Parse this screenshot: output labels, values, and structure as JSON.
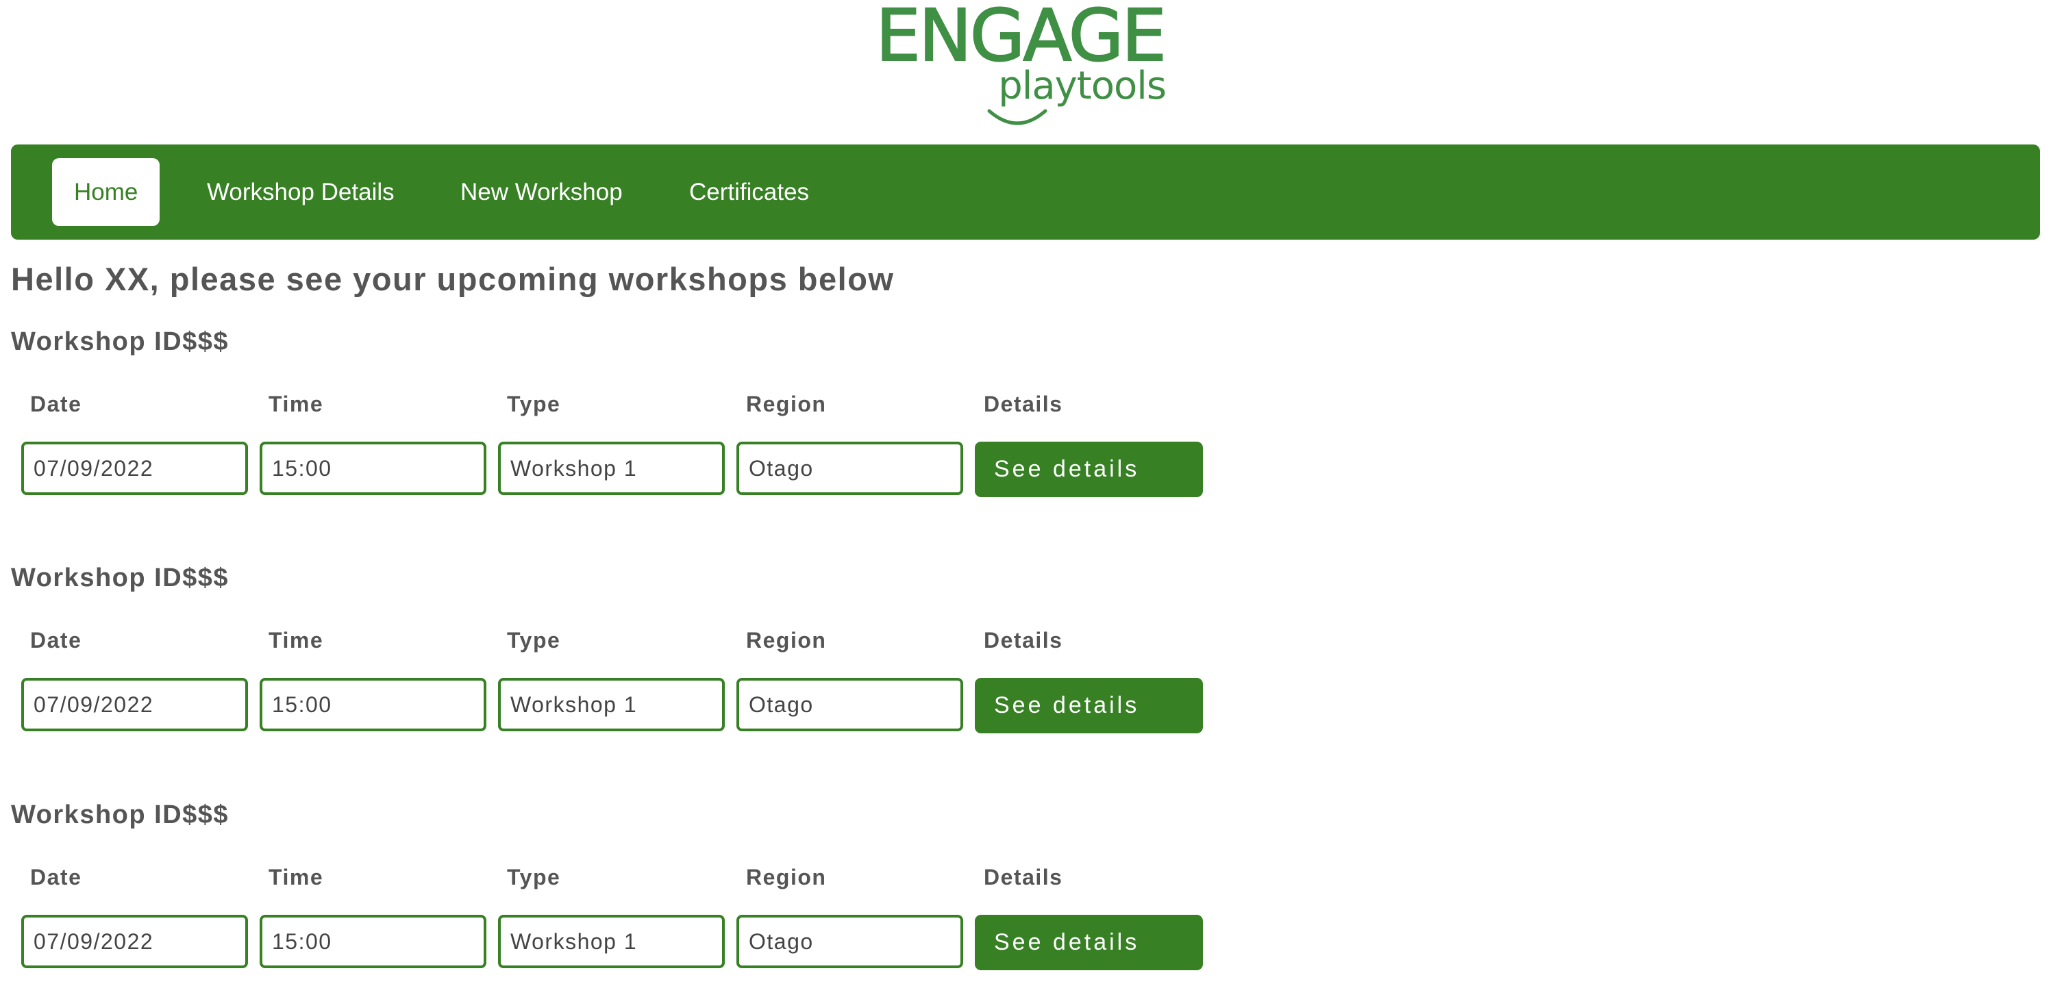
{
  "logo": {
    "word": "ENGAGE",
    "sub": "playtools",
    "color": "#3f8f45"
  },
  "nav": {
    "items": [
      {
        "label": "Home",
        "active": true
      },
      {
        "label": "Workshop Details",
        "active": false
      },
      {
        "label": "New Workshop",
        "active": false
      },
      {
        "label": "Certificates",
        "active": false
      }
    ]
  },
  "greeting": "Hello XX, please see your upcoming workshops below",
  "columns": {
    "date": "Date",
    "time": "Time",
    "type": "Type",
    "region": "Region",
    "details": "Details"
  },
  "workshops": [
    {
      "title": "Workshop ID$$$",
      "date": "07/09/2022",
      "time": "15:00",
      "type": "Workshop 1",
      "region": "Otago",
      "button": "See details"
    },
    {
      "title": "Workshop ID$$$",
      "date": "07/09/2022",
      "time": "15:00",
      "type": "Workshop 1",
      "region": "Otago",
      "button": "See details"
    },
    {
      "title": "Workshop ID$$$",
      "date": "07/09/2022",
      "time": "15:00",
      "type": "Workshop 1",
      "region": "Otago",
      "button": "See details"
    }
  ],
  "colors": {
    "brand_green": "#378024",
    "text_grey": "#555555",
    "background": "#ffffff"
  }
}
